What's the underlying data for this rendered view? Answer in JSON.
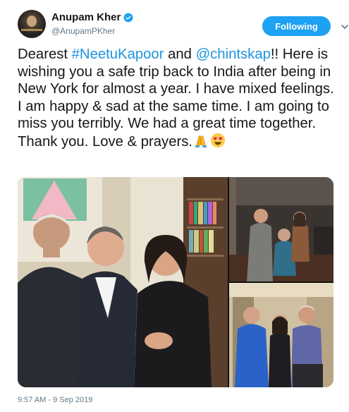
{
  "author": {
    "display_name": "Anupam Kher",
    "handle": "@AnupamPKher",
    "verified": true,
    "avatar_icon": "profile-photo"
  },
  "follow_button": {
    "label": "Following",
    "color": "#1da1f2"
  },
  "menu_caret_icon": "chevron-down-icon",
  "tweet": {
    "segments": [
      {
        "text": "Dearest ",
        "type": "text"
      },
      {
        "text": "#NeetuKapoor",
        "type": "hashtag"
      },
      {
        "text": " and ",
        "type": "text"
      },
      {
        "text": "@chintskap",
        "type": "mention"
      },
      {
        "text": "!! Here is wishing you a safe trip back to India after being in New York for almost a year. I have mixed feelings. I am happy & sad at the same time. I am going to miss you terribly. We had a great time together. Thank you. Love & prayers.",
        "type": "text"
      }
    ],
    "emojis": [
      "folded-hands-emoji",
      "heart-eyes-emoji"
    ],
    "link_color": "#1b95e0"
  },
  "media": {
    "photos": [
      {
        "name": "photo-three-people-indoor",
        "icon": "photo"
      },
      {
        "name": "photo-three-people-restaurant",
        "icon": "photo"
      },
      {
        "name": "photo-three-people-standing",
        "icon": "photo"
      }
    ]
  },
  "timestamp": "9:57 AM - 9 Sep 2019"
}
